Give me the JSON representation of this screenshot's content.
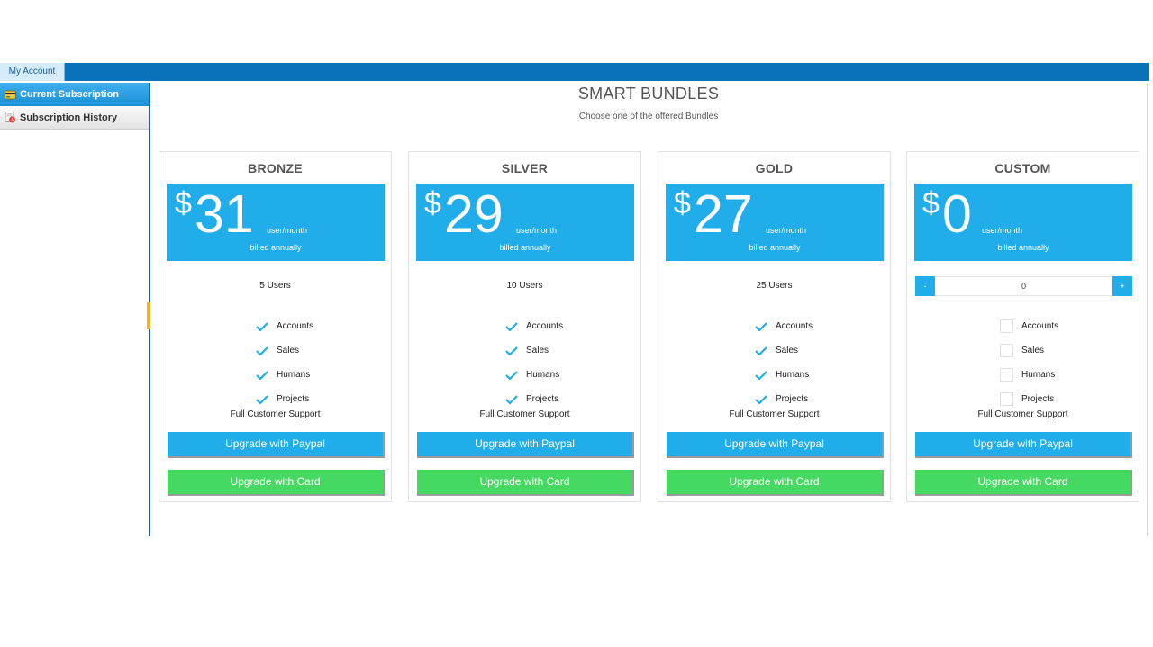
{
  "header": {
    "tab_label": "My Account"
  },
  "sidebar": {
    "items": [
      {
        "label": "Current Subscription"
      },
      {
        "label": "Subscription History"
      }
    ]
  },
  "main": {
    "title": "SMART BUNDLES",
    "subtitle": "Choose one of the offered Bundles"
  },
  "plans": [
    {
      "name": "BRONZE",
      "currency": "$",
      "price": "31",
      "per": "user/month",
      "billing": "billed annually",
      "users": "5 Users",
      "features": [
        "Accounts",
        "Sales",
        "Humans",
        "Projects"
      ],
      "support": "Full Customer Support",
      "paypal_label": "Upgrade with Paypal",
      "card_label": "Upgrade with Card"
    },
    {
      "name": "SILVER",
      "currency": "$",
      "price": "29",
      "per": "user/month",
      "billing": "billed annually",
      "users": "10 Users",
      "features": [
        "Accounts",
        "Sales",
        "Humans",
        "Projects"
      ],
      "support": "Full Customer Support",
      "paypal_label": "Upgrade with Paypal",
      "card_label": "Upgrade with Card"
    },
    {
      "name": "GOLD",
      "currency": "$",
      "price": "27",
      "per": "user/month",
      "billing": "billed annually",
      "users": "25 Users",
      "features": [
        "Accounts",
        "Sales",
        "Humans",
        "Projects"
      ],
      "support": "Full Customer Support",
      "paypal_label": "Upgrade with Paypal",
      "card_label": "Upgrade with Card"
    },
    {
      "name": "CUSTOM",
      "currency": "$",
      "price": "0",
      "per": "user/month",
      "billing": "billed annually",
      "stepper": {
        "minus": "-",
        "plus": "+",
        "value": "0"
      },
      "features": [
        "Accounts",
        "Sales",
        "Humans",
        "Projects"
      ],
      "support": "Full Customer Support",
      "paypal_label": "Upgrade with Paypal",
      "card_label": "Upgrade with Card"
    }
  ],
  "colors": {
    "topbar": "#0a72b8",
    "price_box": "#21adea",
    "paypal_button": "#21adea",
    "card_button": "#45d961",
    "check": "#21adea"
  },
  "icons": {
    "current_subscription": "subscription-card-icon",
    "subscription_history": "history-document-icon",
    "feature_included": "checkmark-icon",
    "feature_optional": "checkbox-icon"
  }
}
